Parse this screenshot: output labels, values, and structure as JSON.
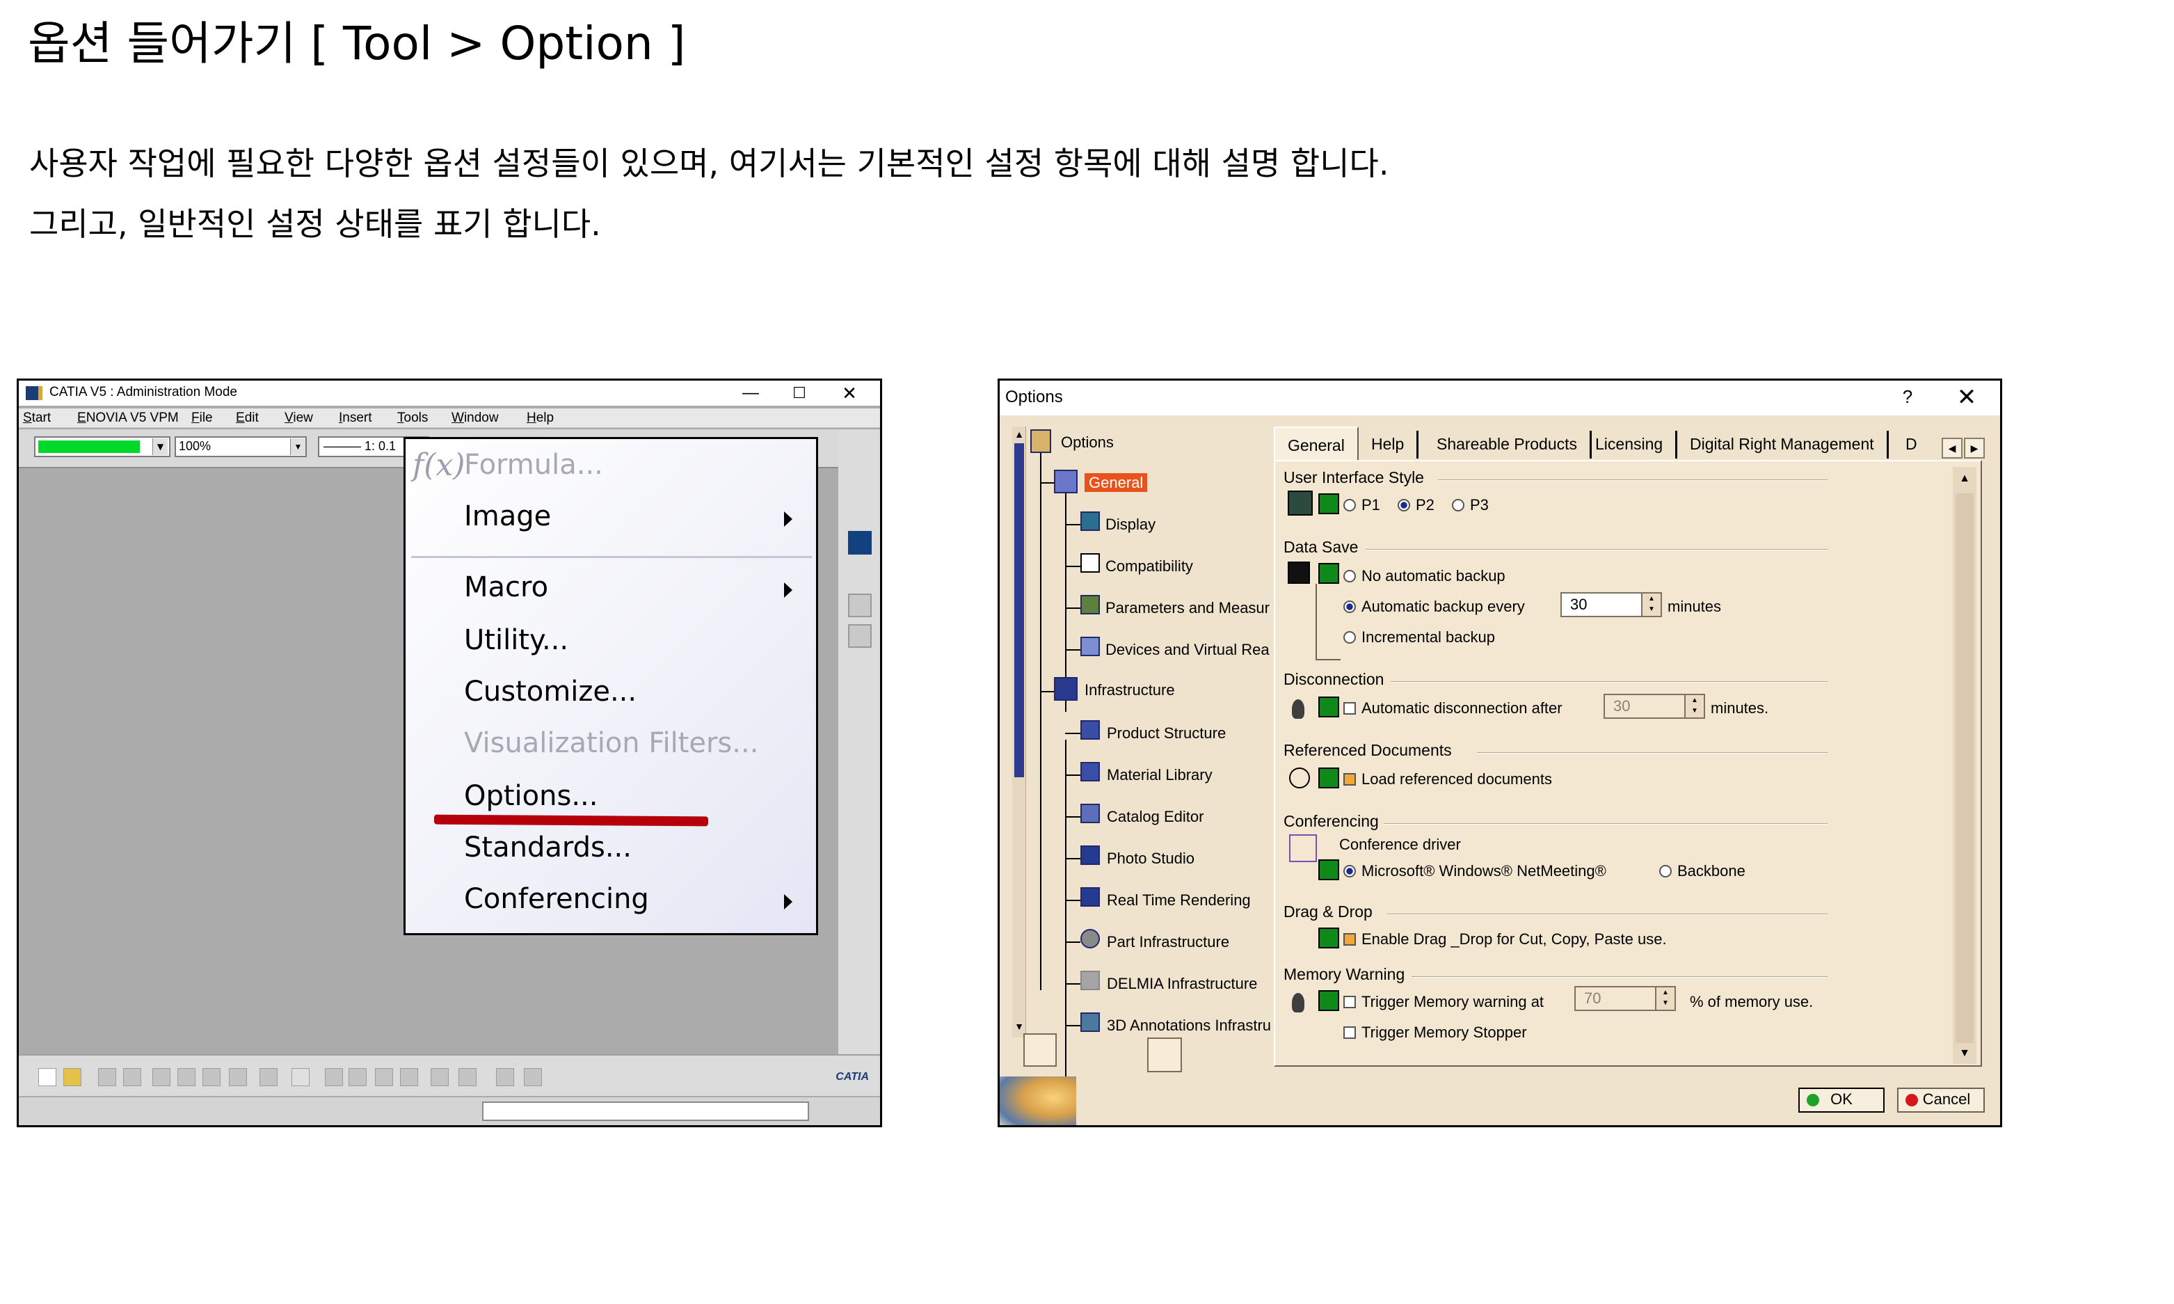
{
  "header": {
    "title": "옵션 들어가기 [ Tool > Option ]",
    "desc_line1": "사용자 작업에 필요한 다양한 옵션 설정들이 있으며, 여기서는 기본적인 설정 항목에 대해 설명 합니다.",
    "desc_line2": "그리고, 일반적인 설정 상태를 표기 합니다."
  },
  "catia": {
    "title": "CATIA V5 : Administration Mode",
    "window_controls": {
      "minimize": "—",
      "maximize": "☐",
      "close": "✕"
    },
    "menubar": [
      "Start",
      "ENOVIA V5 VPM",
      "File",
      "Edit",
      "View",
      "Insert",
      "Tools",
      "Window",
      "Help"
    ],
    "zoom_value": "100%",
    "line_value": "——— 1: 0.1",
    "brand": "CATIA",
    "tools_menu": {
      "formula": "Formula...",
      "image": "Image",
      "macro": "Macro",
      "utility": "Utility...",
      "customize": "Customize...",
      "visualization": "Visualization Filters...",
      "options": "Options...",
      "standards": "Standards...",
      "conferencing": "Conferencing"
    }
  },
  "options": {
    "title": "Options",
    "help": "?",
    "close": "✕",
    "tree": {
      "root": "Options",
      "general": "General",
      "display": "Display",
      "compatibility": "Compatibility",
      "parameters": "Parameters and Measur",
      "devices": "Devices and Virtual Rea",
      "infrastructure": "Infrastructure",
      "product_structure": "Product Structure",
      "material_library": "Material Library",
      "catalog_editor": "Catalog Editor",
      "photo_studio": "Photo Studio",
      "real_time": "Real Time Rendering",
      "part_infra": "Part Infrastructure",
      "delmia": "DELMIA Infrastructure",
      "annotations": "3D Annotations Infrastru"
    },
    "tabs": [
      "General",
      "Help",
      "Shareable Products",
      "Licensing",
      "Digital Right Management",
      "D"
    ],
    "tab_scroll": {
      "left": "◀",
      "right": "▶"
    },
    "ui_style": {
      "heading": "User Interface Style",
      "p1": "P1",
      "p2": "P2",
      "p3": "P3",
      "selected": "P2"
    },
    "data_save": {
      "heading": "Data Save",
      "no_backup": "No automatic backup",
      "auto_backup": "Automatic backup every",
      "auto_value": "30",
      "minutes": "minutes",
      "incremental": "Incremental backup"
    },
    "disconnection": {
      "heading": "Disconnection",
      "label": "Automatic disconnection after",
      "value": "30",
      "minutes": "minutes."
    },
    "referenced": {
      "heading": "Referenced Documents",
      "label": "Load referenced documents"
    },
    "conferencing": {
      "heading": "Conferencing",
      "driver": "Conference driver",
      "netmeeting": "Microsoft® Windows® NetMeeting®",
      "backbone": "Backbone"
    },
    "dragdrop": {
      "heading": "Drag & Drop",
      "label": "Enable Drag _Drop for Cut, Copy, Paste use."
    },
    "memory": {
      "heading": "Memory Warning",
      "trigger": "Trigger Memory warning at",
      "value": "70",
      "unit": "% of memory use.",
      "stopper": "Trigger Memory Stopper"
    },
    "ok": "OK",
    "cancel": "Cancel"
  },
  "colors": {
    "accent_green": "#00d82a",
    "highlight_red": "#b5000b",
    "dialog_bg": "#f0e3cd",
    "tree_selected": "#e8531b"
  }
}
